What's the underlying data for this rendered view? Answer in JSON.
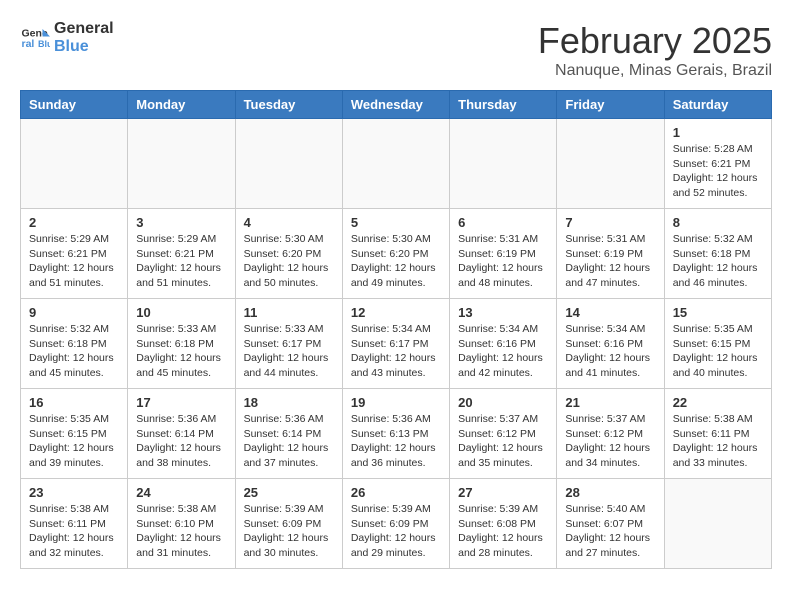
{
  "header": {
    "logo_line1": "General",
    "logo_line2": "Blue",
    "month": "February 2025",
    "location": "Nanuque, Minas Gerais, Brazil"
  },
  "weekdays": [
    "Sunday",
    "Monday",
    "Tuesday",
    "Wednesday",
    "Thursday",
    "Friday",
    "Saturday"
  ],
  "weeks": [
    [
      {
        "day": "",
        "info": ""
      },
      {
        "day": "",
        "info": ""
      },
      {
        "day": "",
        "info": ""
      },
      {
        "day": "",
        "info": ""
      },
      {
        "day": "",
        "info": ""
      },
      {
        "day": "",
        "info": ""
      },
      {
        "day": "1",
        "info": "Sunrise: 5:28 AM\nSunset: 6:21 PM\nDaylight: 12 hours\nand 52 minutes."
      }
    ],
    [
      {
        "day": "2",
        "info": "Sunrise: 5:29 AM\nSunset: 6:21 PM\nDaylight: 12 hours\nand 51 minutes."
      },
      {
        "day": "3",
        "info": "Sunrise: 5:29 AM\nSunset: 6:21 PM\nDaylight: 12 hours\nand 51 minutes."
      },
      {
        "day": "4",
        "info": "Sunrise: 5:30 AM\nSunset: 6:20 PM\nDaylight: 12 hours\nand 50 minutes."
      },
      {
        "day": "5",
        "info": "Sunrise: 5:30 AM\nSunset: 6:20 PM\nDaylight: 12 hours\nand 49 minutes."
      },
      {
        "day": "6",
        "info": "Sunrise: 5:31 AM\nSunset: 6:19 PM\nDaylight: 12 hours\nand 48 minutes."
      },
      {
        "day": "7",
        "info": "Sunrise: 5:31 AM\nSunset: 6:19 PM\nDaylight: 12 hours\nand 47 minutes."
      },
      {
        "day": "8",
        "info": "Sunrise: 5:32 AM\nSunset: 6:18 PM\nDaylight: 12 hours\nand 46 minutes."
      }
    ],
    [
      {
        "day": "9",
        "info": "Sunrise: 5:32 AM\nSunset: 6:18 PM\nDaylight: 12 hours\nand 45 minutes."
      },
      {
        "day": "10",
        "info": "Sunrise: 5:33 AM\nSunset: 6:18 PM\nDaylight: 12 hours\nand 45 minutes."
      },
      {
        "day": "11",
        "info": "Sunrise: 5:33 AM\nSunset: 6:17 PM\nDaylight: 12 hours\nand 44 minutes."
      },
      {
        "day": "12",
        "info": "Sunrise: 5:34 AM\nSunset: 6:17 PM\nDaylight: 12 hours\nand 43 minutes."
      },
      {
        "day": "13",
        "info": "Sunrise: 5:34 AM\nSunset: 6:16 PM\nDaylight: 12 hours\nand 42 minutes."
      },
      {
        "day": "14",
        "info": "Sunrise: 5:34 AM\nSunset: 6:16 PM\nDaylight: 12 hours\nand 41 minutes."
      },
      {
        "day": "15",
        "info": "Sunrise: 5:35 AM\nSunset: 6:15 PM\nDaylight: 12 hours\nand 40 minutes."
      }
    ],
    [
      {
        "day": "16",
        "info": "Sunrise: 5:35 AM\nSunset: 6:15 PM\nDaylight: 12 hours\nand 39 minutes."
      },
      {
        "day": "17",
        "info": "Sunrise: 5:36 AM\nSunset: 6:14 PM\nDaylight: 12 hours\nand 38 minutes."
      },
      {
        "day": "18",
        "info": "Sunrise: 5:36 AM\nSunset: 6:14 PM\nDaylight: 12 hours\nand 37 minutes."
      },
      {
        "day": "19",
        "info": "Sunrise: 5:36 AM\nSunset: 6:13 PM\nDaylight: 12 hours\nand 36 minutes."
      },
      {
        "day": "20",
        "info": "Sunrise: 5:37 AM\nSunset: 6:12 PM\nDaylight: 12 hours\nand 35 minutes."
      },
      {
        "day": "21",
        "info": "Sunrise: 5:37 AM\nSunset: 6:12 PM\nDaylight: 12 hours\nand 34 minutes."
      },
      {
        "day": "22",
        "info": "Sunrise: 5:38 AM\nSunset: 6:11 PM\nDaylight: 12 hours\nand 33 minutes."
      }
    ],
    [
      {
        "day": "23",
        "info": "Sunrise: 5:38 AM\nSunset: 6:11 PM\nDaylight: 12 hours\nand 32 minutes."
      },
      {
        "day": "24",
        "info": "Sunrise: 5:38 AM\nSunset: 6:10 PM\nDaylight: 12 hours\nand 31 minutes."
      },
      {
        "day": "25",
        "info": "Sunrise: 5:39 AM\nSunset: 6:09 PM\nDaylight: 12 hours\nand 30 minutes."
      },
      {
        "day": "26",
        "info": "Sunrise: 5:39 AM\nSunset: 6:09 PM\nDaylight: 12 hours\nand 29 minutes."
      },
      {
        "day": "27",
        "info": "Sunrise: 5:39 AM\nSunset: 6:08 PM\nDaylight: 12 hours\nand 28 minutes."
      },
      {
        "day": "28",
        "info": "Sunrise: 5:40 AM\nSunset: 6:07 PM\nDaylight: 12 hours\nand 27 minutes."
      },
      {
        "day": "",
        "info": ""
      }
    ]
  ]
}
